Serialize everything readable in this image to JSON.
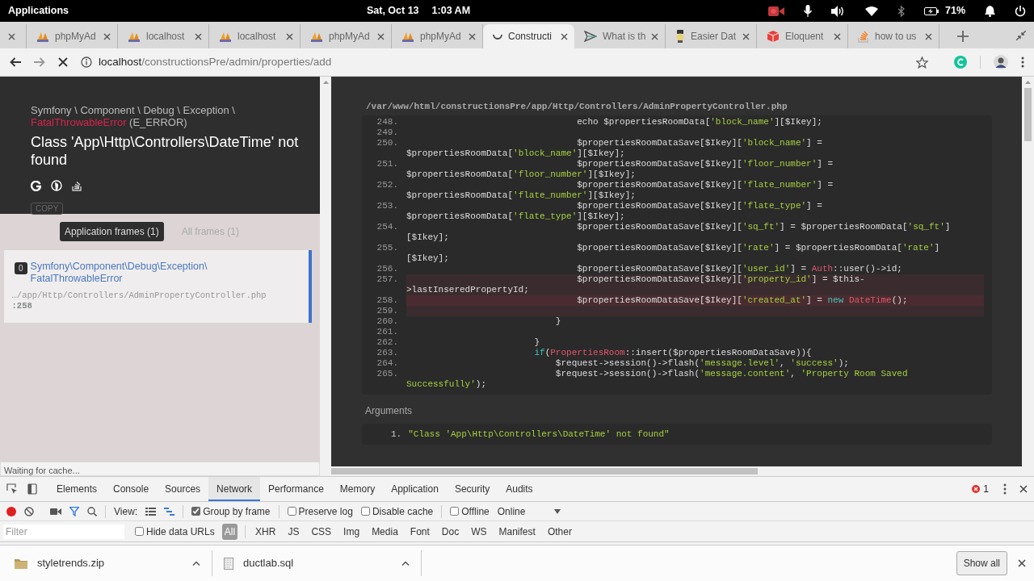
{
  "system_bar": {
    "menu": "Applications",
    "date": "Sat, Oct 13",
    "time": "1:03 AM",
    "battery": "71%"
  },
  "tabs": [
    {
      "kind": "blank",
      "selected": false
    },
    {
      "kind": "pma",
      "title": "phpMyAd",
      "selected": false
    },
    {
      "kind": "pma",
      "title": "localhost",
      "selected": false
    },
    {
      "kind": "pma",
      "title": "localhost",
      "selected": false
    },
    {
      "kind": "pma",
      "title": "phpMyAd",
      "selected": false
    },
    {
      "kind": "pma",
      "title": "phpMyAd",
      "selected": false
    },
    {
      "kind": "loading",
      "title": "Constructi",
      "selected": true
    },
    {
      "kind": "plane",
      "title": "What is th",
      "selected": false
    },
    {
      "kind": "lamp",
      "title": "Easier Dat",
      "selected": false
    },
    {
      "kind": "cube",
      "title": "Eloquent",
      "selected": false
    },
    {
      "kind": "stack",
      "title": "how to us",
      "selected": false
    }
  ],
  "address_bar": {
    "host": "localhost",
    "path": "/constructionsPre/admin/properties/add"
  },
  "error": {
    "namespace": "Symfony \\ Component \\ Debug \\ Exception \\",
    "class": "FatalThrowableError",
    "code": "(E_ERROR)",
    "message": "Class 'App\\Http\\Controllers\\DateTime' not found",
    "copy": "COPY"
  },
  "frame_filters": [
    {
      "label": "Application frames (1)",
      "selected": true
    },
    {
      "label": "All frames (1)",
      "selected": false
    }
  ],
  "frames": [
    {
      "index": "0",
      "class_lines": [
        "Symfony\\Component\\Debug\\Exception\\",
        "FatalThrowableError"
      ],
      "file": "…/app/Http/Controllers/AdminPropertyController.php",
      "line": ":258",
      "selected": true
    }
  ],
  "status": "Waiting for cache...",
  "editor": {
    "path": "/var/www/html/constructionsPre/app/Http/Controllers/AdminPropertyController.php",
    "lines": [
      {
        "num": "248.",
        "highlighted": false,
        "current": false,
        "rows": [
          {
            "segments": [
              {
                "kind": "plain",
                "text": "                                echo $propertiesRoomData["
              },
              {
                "kind": "string",
                "text": "'block_name'"
              },
              {
                "kind": "plain",
                "text": "][$Ikey];"
              }
            ]
          }
        ]
      },
      {
        "num": "249.",
        "highlighted": false,
        "current": false,
        "rows": [
          {
            "segments": []
          }
        ]
      },
      {
        "num": "250.",
        "highlighted": false,
        "current": false,
        "rows": [
          {
            "segments": [
              {
                "kind": "plain",
                "text": "                                $propertiesRoomDataSave[$Ikey]["
              },
              {
                "kind": "string",
                "text": "'block_name'"
              },
              {
                "kind": "plain",
                "text": "] ="
              }
            ]
          },
          {
            "segments": [
              {
                "kind": "plain",
                "text": "$propertiesRoomData["
              },
              {
                "kind": "string",
                "text": "'block_name'"
              },
              {
                "kind": "plain",
                "text": "][$Ikey];"
              }
            ]
          }
        ]
      },
      {
        "num": "251.",
        "highlighted": false,
        "current": false,
        "rows": [
          {
            "segments": [
              {
                "kind": "plain",
                "text": "                                $propertiesRoomDataSave[$Ikey]["
              },
              {
                "kind": "string",
                "text": "'floor_number'"
              },
              {
                "kind": "plain",
                "text": "] ="
              }
            ]
          },
          {
            "segments": [
              {
                "kind": "plain",
                "text": "$propertiesRoomData["
              },
              {
                "kind": "string",
                "text": "'floor_number'"
              },
              {
                "kind": "plain",
                "text": "][$Ikey];"
              }
            ]
          }
        ]
      },
      {
        "num": "252.",
        "highlighted": false,
        "current": false,
        "rows": [
          {
            "segments": [
              {
                "kind": "plain",
                "text": "                                $propertiesRoomDataSave[$Ikey]["
              },
              {
                "kind": "string",
                "text": "'flate_number'"
              },
              {
                "kind": "plain",
                "text": "] ="
              }
            ]
          },
          {
            "segments": [
              {
                "kind": "plain",
                "text": "$propertiesRoomData["
              },
              {
                "kind": "string",
                "text": "'flate_number'"
              },
              {
                "kind": "plain",
                "text": "][$Ikey];"
              }
            ]
          }
        ]
      },
      {
        "num": "253.",
        "highlighted": false,
        "current": false,
        "rows": [
          {
            "segments": [
              {
                "kind": "plain",
                "text": "                                $propertiesRoomDataSave[$Ikey]["
              },
              {
                "kind": "string",
                "text": "'flate_type'"
              },
              {
                "kind": "plain",
                "text": "] ="
              }
            ]
          },
          {
            "segments": [
              {
                "kind": "plain",
                "text": "$propertiesRoomData["
              },
              {
                "kind": "string",
                "text": "'flate_type'"
              },
              {
                "kind": "plain",
                "text": "][$Ikey];"
              }
            ]
          }
        ]
      },
      {
        "num": "254.",
        "highlighted": false,
        "current": false,
        "rows": [
          {
            "segments": [
              {
                "kind": "plain",
                "text": "                                $propertiesRoomDataSave[$Ikey]["
              },
              {
                "kind": "string",
                "text": "'sq_ft'"
              },
              {
                "kind": "plain",
                "text": "] = $propertiesRoomData["
              },
              {
                "kind": "string",
                "text": "'sq_ft'"
              },
              {
                "kind": "plain",
                "text": "]"
              }
            ]
          },
          {
            "segments": [
              {
                "kind": "plain",
                "text": "[$Ikey];"
              }
            ]
          }
        ]
      },
      {
        "num": "255.",
        "highlighted": false,
        "current": false,
        "rows": [
          {
            "segments": [
              {
                "kind": "plain",
                "text": "                                $propertiesRoomDataSave[$Ikey]["
              },
              {
                "kind": "string",
                "text": "'rate'"
              },
              {
                "kind": "plain",
                "text": "] = $propertiesRoomData["
              },
              {
                "kind": "string",
                "text": "'rate'"
              },
              {
                "kind": "plain",
                "text": "]"
              }
            ]
          },
          {
            "segments": [
              {
                "kind": "plain",
                "text": "[$Ikey];"
              }
            ]
          }
        ]
      },
      {
        "num": "256.",
        "highlighted": false,
        "current": false,
        "rows": [
          {
            "segments": [
              {
                "kind": "plain",
                "text": "                                $propertiesRoomDataSave[$Ikey]["
              },
              {
                "kind": "string",
                "text": "'user_id'"
              },
              {
                "kind": "plain",
                "text": "] = "
              },
              {
                "kind": "class",
                "text": "Auth"
              },
              {
                "kind": "plain",
                "text": "::user()->id;"
              }
            ]
          }
        ]
      },
      {
        "num": "257.",
        "highlighted": true,
        "current": false,
        "rows": [
          {
            "segments": [
              {
                "kind": "plain",
                "text": "                                $propertiesRoomDataSave[$Ikey]["
              },
              {
                "kind": "string",
                "text": "'property_id'"
              },
              {
                "kind": "plain",
                "text": "] = $this-"
              }
            ]
          },
          {
            "segments": [
              {
                "kind": "plain",
                "text": ">lastInseredPropertyId;"
              }
            ]
          }
        ]
      },
      {
        "num": "258.",
        "highlighted": true,
        "current": true,
        "rows": [
          {
            "segments": [
              {
                "kind": "plain",
                "text": "                                $propertiesRoomDataSave[$Ikey]["
              },
              {
                "kind": "string",
                "text": "'created_at'"
              },
              {
                "kind": "plain",
                "text": "] = "
              },
              {
                "kind": "keyword",
                "text": "new"
              },
              {
                "kind": "class",
                "text": " DateTime"
              },
              {
                "kind": "plain",
                "text": "();"
              }
            ]
          }
        ]
      },
      {
        "num": "259.",
        "highlighted": true,
        "current": false,
        "rows": [
          {
            "segments": []
          }
        ]
      },
      {
        "num": "260.",
        "highlighted": false,
        "current": false,
        "rows": [
          {
            "segments": [
              {
                "kind": "plain",
                "text": "                            }"
              }
            ]
          }
        ]
      },
      {
        "num": "261.",
        "highlighted": false,
        "current": false,
        "rows": [
          {
            "segments": []
          }
        ]
      },
      {
        "num": "262.",
        "highlighted": false,
        "current": false,
        "rows": [
          {
            "segments": [
              {
                "kind": "plain",
                "text": "                        }"
              }
            ]
          }
        ]
      },
      {
        "num": "263.",
        "highlighted": false,
        "current": false,
        "rows": [
          {
            "segments": [
              {
                "kind": "keyword",
                "text": "                        if"
              },
              {
                "kind": "plain",
                "text": "("
              },
              {
                "kind": "class",
                "text": "PropertiesRoom"
              },
              {
                "kind": "plain",
                "text": "::insert($propertiesRoomDataSave)){"
              }
            ]
          }
        ]
      },
      {
        "num": "264.",
        "highlighted": false,
        "current": false,
        "rows": [
          {
            "segments": [
              {
                "kind": "plain",
                "text": "                            $request->session()->flash("
              },
              {
                "kind": "string",
                "text": "'message.level'"
              },
              {
                "kind": "plain",
                "text": ", "
              },
              {
                "kind": "string",
                "text": "'success'"
              },
              {
                "kind": "plain",
                "text": ");"
              }
            ]
          }
        ]
      },
      {
        "num": "265.",
        "highlighted": false,
        "current": false,
        "rows": [
          {
            "segments": [
              {
                "kind": "plain",
                "text": "                            $request->session()->flash("
              },
              {
                "kind": "string",
                "text": "'message.content'"
              },
              {
                "kind": "plain",
                "text": ", "
              },
              {
                "kind": "string",
                "text": "'Property Room Saved"
              }
            ]
          },
          {
            "segments": [
              {
                "kind": "string",
                "text": "Successfully'"
              },
              {
                "kind": "plain",
                "text": ");"
              }
            ]
          }
        ]
      }
    ],
    "arguments_title": "Arguments",
    "arguments": [
      {
        "num": "1.",
        "value": "\"Class 'App\\Http\\Controllers\\DateTime' not found\""
      }
    ]
  },
  "devtools": {
    "tabs": [
      {
        "label": "Elements",
        "selected": false
      },
      {
        "label": "Console",
        "selected": false
      },
      {
        "label": "Sources",
        "selected": false
      },
      {
        "label": "Network",
        "selected": true
      },
      {
        "label": "Performance",
        "selected": false
      },
      {
        "label": "Memory",
        "selected": false
      },
      {
        "label": "Application",
        "selected": false
      },
      {
        "label": "Security",
        "selected": false
      },
      {
        "label": "Audits",
        "selected": false
      }
    ],
    "errors": "1",
    "view_label": "View:",
    "options": [
      {
        "label": "Group by frame",
        "checked": true
      },
      {
        "label": "Preserve log",
        "checked": false
      },
      {
        "label": "Disable cache",
        "checked": false
      },
      {
        "label": "Offline",
        "checked": false
      }
    ],
    "throttle": "Online",
    "filter": {
      "placeholder": "Filter"
    },
    "hide_data_urls": {
      "label": "Hide data URLs",
      "checked": false
    },
    "types": [
      {
        "label": "All",
        "selected": true
      },
      {
        "label": "XHR",
        "selected": false
      },
      {
        "label": "JS",
        "selected": false
      },
      {
        "label": "CSS",
        "selected": false
      },
      {
        "label": "Img",
        "selected": false
      },
      {
        "label": "Media",
        "selected": false
      },
      {
        "label": "Font",
        "selected": false
      },
      {
        "label": "Doc",
        "selected": false
      },
      {
        "label": "WS",
        "selected": false
      },
      {
        "label": "Manifest",
        "selected": false
      },
      {
        "label": "Other",
        "selected": false
      }
    ]
  },
  "downloads": {
    "files": [
      {
        "name": "styletrends.zip",
        "kind": "archive"
      },
      {
        "name": "ductlab.sql",
        "kind": "document"
      }
    ],
    "show_all": "Show all"
  }
}
